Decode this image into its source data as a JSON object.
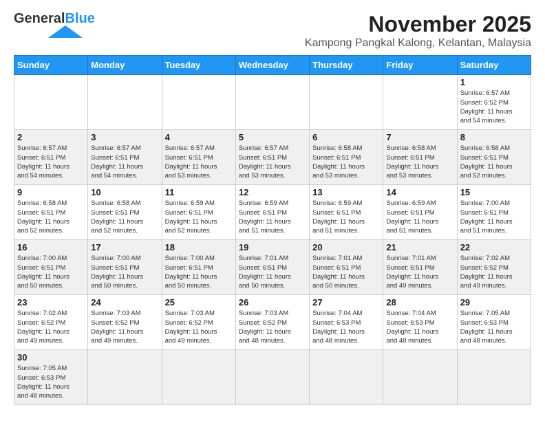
{
  "header": {
    "logo_general": "General",
    "logo_blue": "Blue",
    "title": "November 2025",
    "subtitle": "Kampong Pangkal Kalong, Kelantan, Malaysia"
  },
  "days_of_week": [
    "Sunday",
    "Monday",
    "Tuesday",
    "Wednesday",
    "Thursday",
    "Friday",
    "Saturday"
  ],
  "weeks": [
    [
      {
        "day": "",
        "info": ""
      },
      {
        "day": "",
        "info": ""
      },
      {
        "day": "",
        "info": ""
      },
      {
        "day": "",
        "info": ""
      },
      {
        "day": "",
        "info": ""
      },
      {
        "day": "",
        "info": ""
      },
      {
        "day": "1",
        "info": "Sunrise: 6:57 AM\nSunset: 6:52 PM\nDaylight: 11 hours\nand 54 minutes."
      }
    ],
    [
      {
        "day": "2",
        "info": "Sunrise: 6:57 AM\nSunset: 6:51 PM\nDaylight: 11 hours\nand 54 minutes."
      },
      {
        "day": "3",
        "info": "Sunrise: 6:57 AM\nSunset: 6:51 PM\nDaylight: 11 hours\nand 54 minutes."
      },
      {
        "day": "4",
        "info": "Sunrise: 6:57 AM\nSunset: 6:51 PM\nDaylight: 11 hours\nand 53 minutes."
      },
      {
        "day": "5",
        "info": "Sunrise: 6:57 AM\nSunset: 6:51 PM\nDaylight: 11 hours\nand 53 minutes."
      },
      {
        "day": "6",
        "info": "Sunrise: 6:58 AM\nSunset: 6:51 PM\nDaylight: 11 hours\nand 53 minutes."
      },
      {
        "day": "7",
        "info": "Sunrise: 6:58 AM\nSunset: 6:51 PM\nDaylight: 11 hours\nand 53 minutes."
      },
      {
        "day": "8",
        "info": "Sunrise: 6:58 AM\nSunset: 6:51 PM\nDaylight: 11 hours\nand 52 minutes."
      }
    ],
    [
      {
        "day": "9",
        "info": "Sunrise: 6:58 AM\nSunset: 6:51 PM\nDaylight: 11 hours\nand 52 minutes."
      },
      {
        "day": "10",
        "info": "Sunrise: 6:58 AM\nSunset: 6:51 PM\nDaylight: 11 hours\nand 52 minutes."
      },
      {
        "day": "11",
        "info": "Sunrise: 6:59 AM\nSunset: 6:51 PM\nDaylight: 11 hours\nand 52 minutes."
      },
      {
        "day": "12",
        "info": "Sunrise: 6:59 AM\nSunset: 6:51 PM\nDaylight: 11 hours\nand 51 minutes."
      },
      {
        "day": "13",
        "info": "Sunrise: 6:59 AM\nSunset: 6:51 PM\nDaylight: 11 hours\nand 51 minutes."
      },
      {
        "day": "14",
        "info": "Sunrise: 6:59 AM\nSunset: 6:51 PM\nDaylight: 11 hours\nand 51 minutes."
      },
      {
        "day": "15",
        "info": "Sunrise: 7:00 AM\nSunset: 6:51 PM\nDaylight: 11 hours\nand 51 minutes."
      }
    ],
    [
      {
        "day": "16",
        "info": "Sunrise: 7:00 AM\nSunset: 6:51 PM\nDaylight: 11 hours\nand 50 minutes."
      },
      {
        "day": "17",
        "info": "Sunrise: 7:00 AM\nSunset: 6:51 PM\nDaylight: 11 hours\nand 50 minutes."
      },
      {
        "day": "18",
        "info": "Sunrise: 7:00 AM\nSunset: 6:51 PM\nDaylight: 11 hours\nand 50 minutes."
      },
      {
        "day": "19",
        "info": "Sunrise: 7:01 AM\nSunset: 6:51 PM\nDaylight: 11 hours\nand 50 minutes."
      },
      {
        "day": "20",
        "info": "Sunrise: 7:01 AM\nSunset: 6:51 PM\nDaylight: 11 hours\nand 50 minutes."
      },
      {
        "day": "21",
        "info": "Sunrise: 7:01 AM\nSunset: 6:51 PM\nDaylight: 11 hours\nand 49 minutes."
      },
      {
        "day": "22",
        "info": "Sunrise: 7:02 AM\nSunset: 6:52 PM\nDaylight: 11 hours\nand 49 minutes."
      }
    ],
    [
      {
        "day": "23",
        "info": "Sunrise: 7:02 AM\nSunset: 6:52 PM\nDaylight: 11 hours\nand 49 minutes."
      },
      {
        "day": "24",
        "info": "Sunrise: 7:03 AM\nSunset: 6:52 PM\nDaylight: 11 hours\nand 49 minutes."
      },
      {
        "day": "25",
        "info": "Sunrise: 7:03 AM\nSunset: 6:52 PM\nDaylight: 11 hours\nand 49 minutes."
      },
      {
        "day": "26",
        "info": "Sunrise: 7:03 AM\nSunset: 6:52 PM\nDaylight: 11 hours\nand 48 minutes."
      },
      {
        "day": "27",
        "info": "Sunrise: 7:04 AM\nSunset: 6:53 PM\nDaylight: 11 hours\nand 48 minutes."
      },
      {
        "day": "28",
        "info": "Sunrise: 7:04 AM\nSunset: 6:53 PM\nDaylight: 11 hours\nand 48 minutes."
      },
      {
        "day": "29",
        "info": "Sunrise: 7:05 AM\nSunset: 6:53 PM\nDaylight: 11 hours\nand 48 minutes."
      }
    ],
    [
      {
        "day": "30",
        "info": "Sunrise: 7:05 AM\nSunset: 6:53 PM\nDaylight: 11 hours\nand 48 minutes."
      },
      {
        "day": "",
        "info": ""
      },
      {
        "day": "",
        "info": ""
      },
      {
        "day": "",
        "info": ""
      },
      {
        "day": "",
        "info": ""
      },
      {
        "day": "",
        "info": ""
      },
      {
        "day": "",
        "info": ""
      }
    ]
  ]
}
